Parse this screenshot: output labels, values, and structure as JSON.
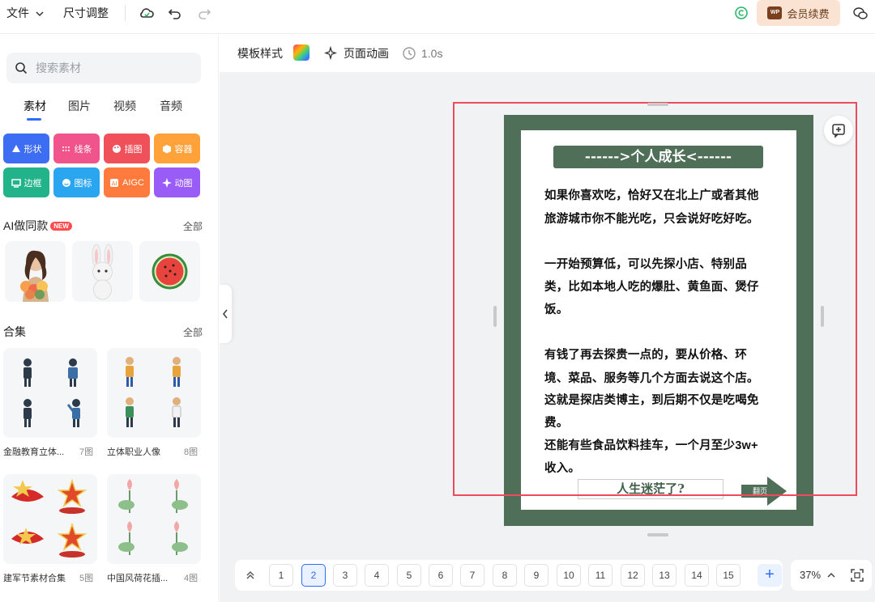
{
  "topbar": {
    "file_label": "文件",
    "resize_label": "尺寸调整",
    "vip_label": "会员续费",
    "vip_badge": "WP"
  },
  "sidebar": {
    "search_placeholder": "搜索素材",
    "tabs": [
      {
        "label": "素材",
        "active": true
      },
      {
        "label": "图片",
        "active": false
      },
      {
        "label": "视频",
        "active": false
      },
      {
        "label": "音频",
        "active": false
      }
    ],
    "tools": [
      {
        "label": "形状",
        "icon": "shape-icon",
        "color": "#3d6df2"
      },
      {
        "label": "线条",
        "icon": "line-icon",
        "color": "#f0548a"
      },
      {
        "label": "插图",
        "icon": "palette-icon",
        "color": "#f0505a"
      },
      {
        "label": "容器",
        "icon": "box-icon",
        "color": "#ffa23a"
      },
      {
        "label": "边框",
        "icon": "frame-icon",
        "color": "#23b38a"
      },
      {
        "label": "图标",
        "icon": "smile-icon",
        "color": "#2aa5f0"
      },
      {
        "label": "AIGC",
        "icon": "ai-icon",
        "color": "#ff7a3d"
      },
      {
        "label": "动图",
        "icon": "sparkle-icon",
        "color": "#9a5cf6"
      }
    ],
    "ai_section": {
      "title": "AI做同款",
      "badge": "NEW",
      "all_label": "全部"
    },
    "collection_section": {
      "title": "合集",
      "all_label": "全部"
    },
    "collections": [
      {
        "name": "金融教育立体...",
        "count": "7图"
      },
      {
        "name": "立体职业人像",
        "count": "8图"
      },
      {
        "name": "建军节素材合集",
        "count": "5图"
      },
      {
        "name": "中国风荷花插...",
        "count": "4图"
      }
    ]
  },
  "subbar": {
    "template_style_label": "模板样式",
    "page_animation_label": "页面动画",
    "duration_label": "1.0s"
  },
  "poster": {
    "title": "------>个人成长<------",
    "lines": [
      "如果你喜欢吃，恰好又在北上广或者其他",
      "旅游城市你不能光吃，只会说好吃好吃。",
      "一开始预算低，可以先探小店、特别品",
      "类，比如本地人吃的爆肚、黄鱼面、煲仔",
      "饭。",
      "有钱了再去探贵一点的，要从价格、环",
      "境、菜品、服务等几个方面去说这个店。",
      "这就是探店类博主，到后期不仅是吃喝免",
      "费。",
      "还能有些食品饮料挂车，一个月至少3w+",
      "收入。"
    ],
    "question": "人生迷茫了?",
    "arrow_label": "翻页",
    "frame_color": "#4f6f58"
  },
  "pager": {
    "pages": [
      "1",
      "2",
      "3",
      "4",
      "5",
      "6",
      "7",
      "8",
      "9",
      "10",
      "11",
      "12",
      "13",
      "14",
      "15"
    ],
    "current_page": "2",
    "zoom_label": "37%"
  }
}
